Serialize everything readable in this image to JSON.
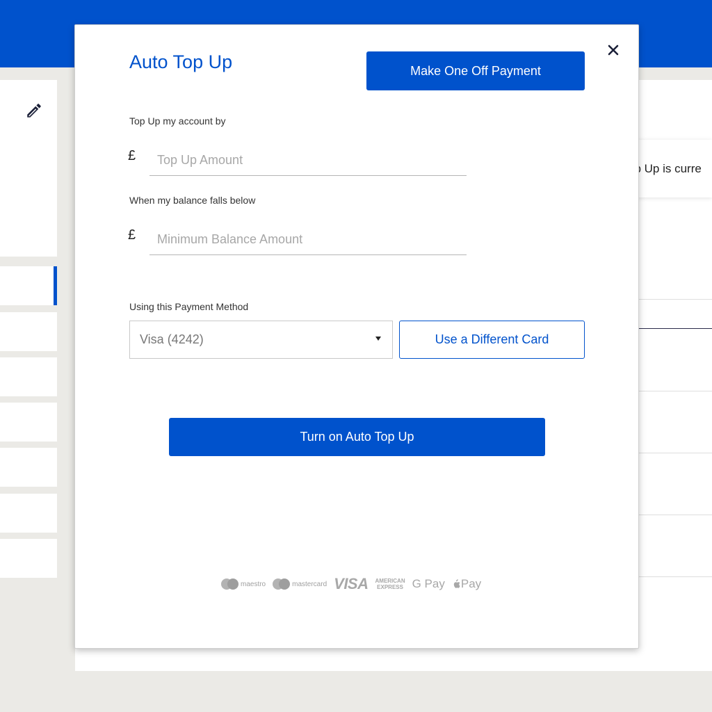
{
  "modal": {
    "title": "Auto Top Up",
    "one_off_button": "Make One Off Payment",
    "topup_label": "Top Up my account by",
    "topup_currency": "£",
    "topup_placeholder": "Top Up Amount",
    "minbal_label": "When my balance falls below",
    "minbal_currency": "£",
    "minbal_placeholder": "Minimum Balance Amount",
    "payment_label": "Using this Payment Method",
    "payment_selected": "Visa (4242)",
    "different_card_button": "Use a Different Card",
    "turn_on_button": "Turn on Auto Top Up",
    "payment_logos": {
      "maestro": "maestro",
      "mastercard": "mastercard",
      "visa": "VISA",
      "amex_line1": "AMERICAN",
      "amex_line2": "EXPRESS",
      "gpay": "G Pay",
      "applepay": "Pay"
    }
  },
  "background": {
    "banner_text": "op Up is curre"
  },
  "colors": {
    "brand_blue": "#0052cc",
    "page_bg": "#ebeae6"
  }
}
